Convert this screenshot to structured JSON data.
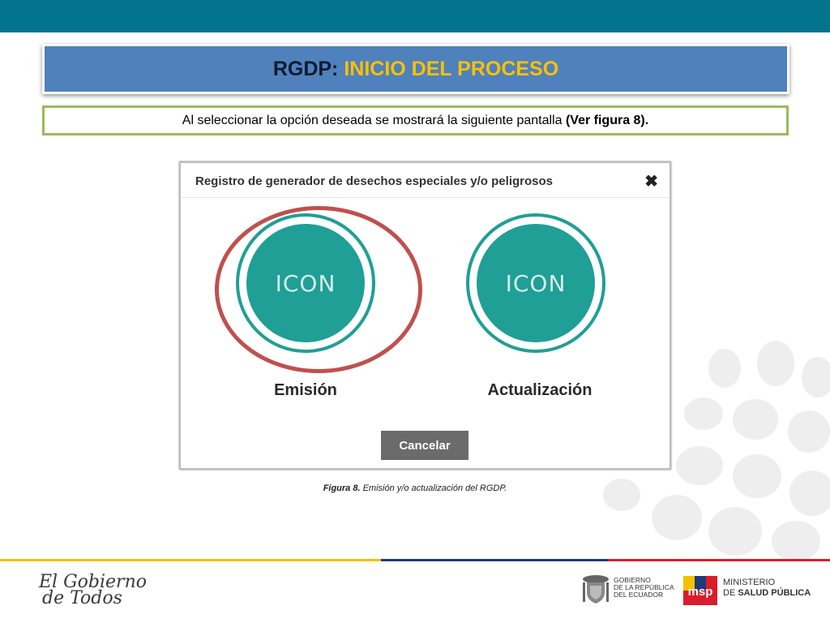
{
  "slide": {
    "title_prefix": "RGDP: ",
    "title_accent": "INICIO DEL PROCESO",
    "subtitle_text": "Al seleccionar la opción deseada se mostrará la siguiente pantalla ",
    "subtitle_bold": "(Ver figura 8).",
    "caption_bold": "Figura 8.",
    "caption_text": " Emisión y/o actualización del RGDP."
  },
  "dialog": {
    "title": "Registro de generador de desechos especiales y/o peligrosos",
    "close_glyph": "✖",
    "options": [
      {
        "icon_text": "ICON",
        "label": "Emisión",
        "highlighted": true
      },
      {
        "icon_text": "ICON",
        "label": "Actualización",
        "highlighted": false
      }
    ],
    "cancel_label": "Cancelar"
  },
  "footer": {
    "gobierno_logo_line1": "El Gobierno",
    "gobierno_logo_line2": "de Todos",
    "gobierno_line1": "GOBIERNO",
    "gobierno_line2": "DE LA REPÚBLICA",
    "gobierno_line3": "DEL ECUADOR",
    "ministerio_line1": "MINISTERIO",
    "ministerio_line2_prefix": "DE ",
    "ministerio_line2_bold": "SALUD PÚBLICA",
    "msp_logo_text": "msp"
  },
  "colors": {
    "top_bar": "#04748e",
    "title_bg": "#4f81bd",
    "title_accent": "#ffc000",
    "subtitle_border": "#9bbb59",
    "teal": "#1f9f96",
    "highlight_ring": "#c0504d",
    "cancel_bg": "#6b6b6b",
    "footer_yellow": "#f2c200",
    "footer_blue": "#1f3a78",
    "footer_red": "#d81e2c"
  }
}
